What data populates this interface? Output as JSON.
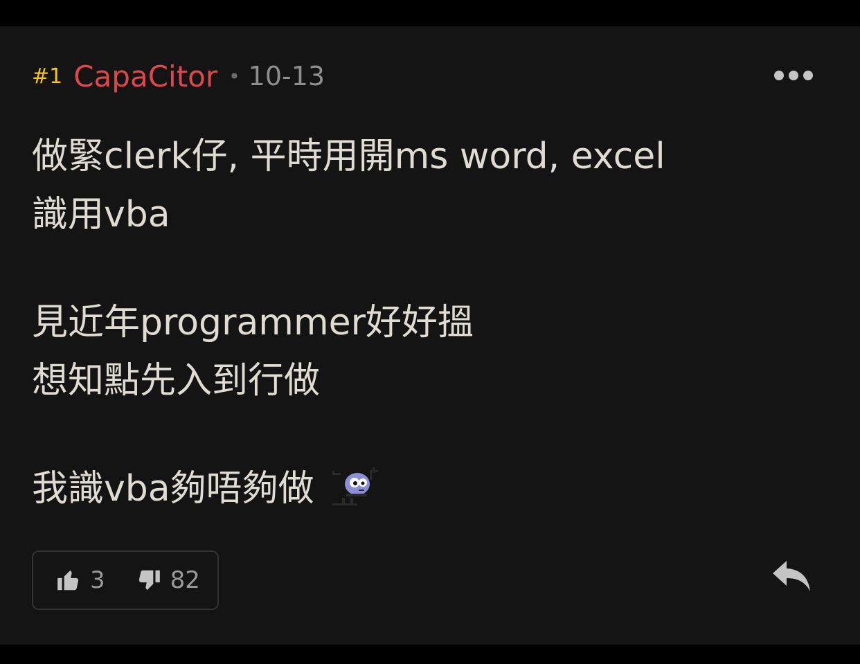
{
  "post": {
    "floor": "#1",
    "author": "CapaCitor",
    "separator": "•",
    "date": "10-13",
    "body_lines": [
      "做緊clerk仔, 平時用開ms word, excel",
      "識用vba",
      "",
      "見近年programmer好好搵",
      "想知點先入到行做",
      "",
      "我識vba夠唔夠做"
    ],
    "emoji": "thinking-sticker"
  },
  "votes": {
    "like_count": "3",
    "dislike_count": "82"
  },
  "icons": {
    "more": "more-horizontal-icon",
    "like": "thumbs-up-icon",
    "dislike": "thumbs-down-icon",
    "reply": "reply-icon"
  },
  "colors": {
    "background": "#141414",
    "floor": "#f5c518",
    "author": "#e0474c",
    "date": "#8e8e8e",
    "body_text": "#e0dcd4",
    "vote_border": "#333333",
    "icon": "#c4c4c4"
  }
}
